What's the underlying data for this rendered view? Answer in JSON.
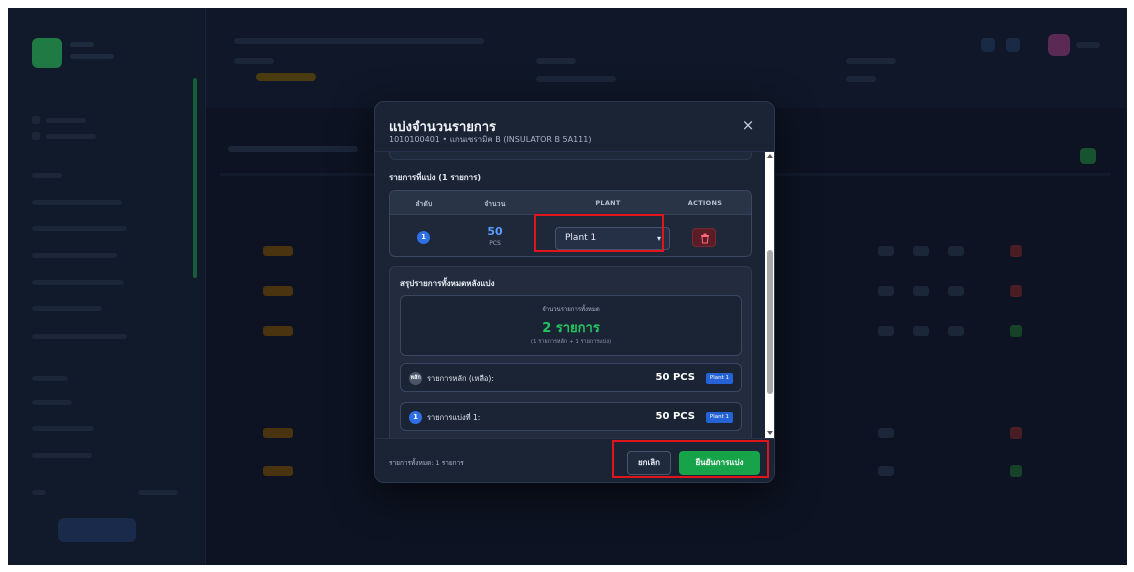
{
  "modal": {
    "title": "แบ่งจำนวนรายการ",
    "subtitle": "1010100401 • แกนเซรามิค B (INSULATOR B 5A111)",
    "close_label": "×"
  },
  "split_section": {
    "title": "รายการที่แบ่ง (1 รายการ)",
    "columns": [
      "ลำดับ",
      "จำนวน",
      "PLANT",
      "ACTIONS"
    ],
    "rows": [
      {
        "seq": "1",
        "qty": "50",
        "unit": "PCS",
        "plant": "Plant 1",
        "delete_icon": "trash-icon"
      }
    ]
  },
  "summary": {
    "title": "สรุปรายการทั้งหมดหลังแบ่ง",
    "total_label": "จำนวนรายการทั้งหมด",
    "total_value": "2 รายการ",
    "total_note": "(1 รายการหลัก + 1 รายการแบ่ง)",
    "items": [
      {
        "icon": "หลัก",
        "label": "รายการหลัก (เหลือ):",
        "qty": "50 PCS",
        "plant": "Plant 1"
      },
      {
        "icon": "1",
        "label": "รายการแบ่งที่ 1:",
        "qty": "50 PCS",
        "plant": "Plant 1"
      }
    ]
  },
  "footer": {
    "total_text": "รายการทั้งหมด: 1 รายการ",
    "cancel_label": "ยกเลิก",
    "confirm_label": "ยืนยันการแบ่ง"
  },
  "colors": {
    "accent_blue": "#2f6fe4",
    "success_green": "#16a34a",
    "danger_red": "#5a1d27",
    "highlight_red": "#e0141b"
  }
}
